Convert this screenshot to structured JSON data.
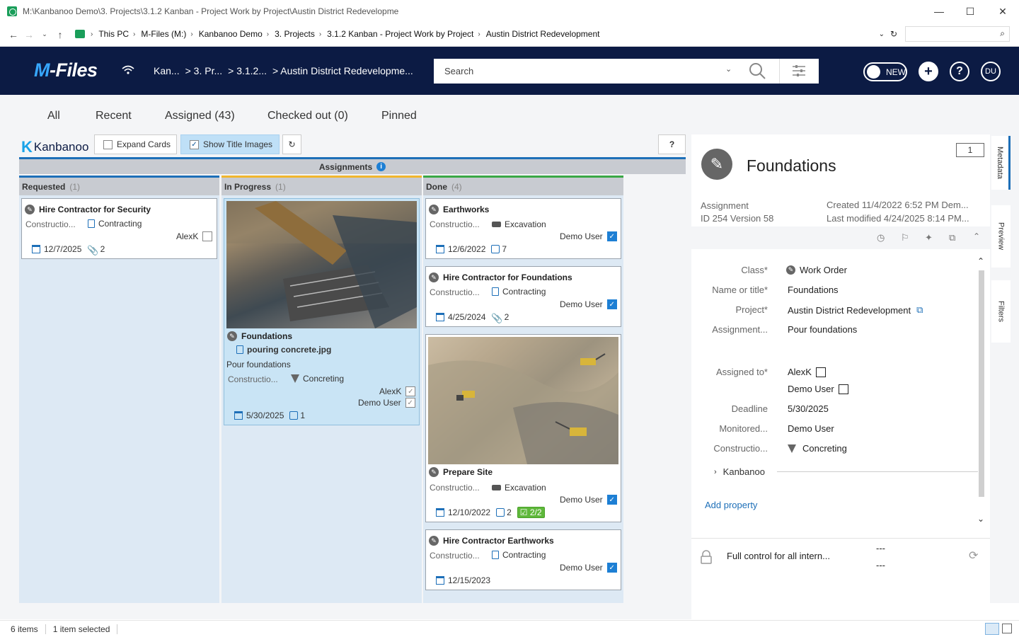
{
  "window": {
    "title": "M:\\Kanbanoo Demo\\3. Projects\\3.1.2 Kanban - Project Work by Project\\Austin District Redevelopme",
    "minimize": "—",
    "maximize": "☐",
    "close": "✕"
  },
  "address": {
    "crumbs": [
      "This PC",
      "M-Files (M:)",
      "Kanbanoo Demo",
      "3. Projects",
      "3.1.2 Kanban - Project Work by Project",
      "Austin District Redevelopment"
    ]
  },
  "header": {
    "logo_m": "M",
    "logo_rest": "-Files",
    "crumbs": [
      "Kan...",
      "> 3. Pr...",
      "> 3.1.2...",
      "> Austin District Redevelopme..."
    ],
    "search_placeholder": "Search",
    "new_label": "NEW",
    "user_initials": "DU"
  },
  "tabs": [
    "All",
    "Recent",
    "Assigned (43)",
    "Checked out (0)",
    "Pinned"
  ],
  "toolbar": {
    "brand": "Kanbanoo",
    "expand_cards": "Expand Cards",
    "show_title_images": "Show Title Images",
    "help": "?"
  },
  "board": {
    "title": "Assignments",
    "columns": [
      {
        "name": "Requested",
        "count": "(1)",
        "color": "#1d6fb8"
      },
      {
        "name": "In Progress",
        "count": "(1)",
        "color": "#f0b62e"
      },
      {
        "name": "Done",
        "count": "(4)",
        "color": "#3aa845"
      }
    ],
    "cards": {
      "c1": {
        "title": "Hire Contractor for Security",
        "category": "Constructio...",
        "type": "Contracting",
        "assignee": "AlexK",
        "date": "12/7/2025",
        "attachments": "2"
      },
      "c2": {
        "title": "Foundations",
        "file": "pouring concrete.jpg",
        "desc": "Pour foundations",
        "category": "Constructio...",
        "type": "Concreting",
        "assignee1": "AlexK",
        "assignee2": "Demo User",
        "date": "5/30/2025",
        "comments": "1"
      },
      "c3": {
        "title": "Earthworks",
        "category": "Constructio...",
        "type": "Excavation",
        "assignee": "Demo User",
        "date": "12/6/2022",
        "comments": "7"
      },
      "c4": {
        "title": "Hire Contractor for Foundations",
        "category": "Constructio...",
        "type": "Contracting",
        "assignee": "Demo User",
        "date": "4/25/2024",
        "attachments": "2"
      },
      "c5": {
        "title": "Prepare Site",
        "category": "Constructio...",
        "type": "Excavation",
        "assignee": "Demo User",
        "date": "12/10/2022",
        "comments": "2",
        "tasks": "2/2"
      },
      "c6": {
        "title": "Hire Contractor Earthworks",
        "category": "Constructio...",
        "type": "Contracting",
        "assignee": "Demo User",
        "date": "12/15/2023"
      }
    }
  },
  "panel": {
    "title": "Foundations",
    "comment_count": "1",
    "obj_type": "Assignment",
    "obj_id": "ID 254  Version 58",
    "created": "Created 11/4/2022 6:52 PM Dem...",
    "modified": "Last modified 4/24/2025 8:14 PM...",
    "props": {
      "class_label": "Class*",
      "class_value": "Work Order",
      "name_label": "Name or title*",
      "name_value": "Foundations",
      "project_label": "Project*",
      "project_value": "Austin District Redevelopment",
      "assign_label": "Assignment...",
      "assign_value": "Pour foundations",
      "assigned_label": "Assigned to*",
      "assigned_1": "AlexK",
      "assigned_2": "Demo User",
      "deadline_label": "Deadline",
      "deadline_value": "5/30/2025",
      "monitored_label": "Monitored...",
      "monitored_value": "Demo User",
      "constr_label": "Constructio...",
      "constr_value": "Concreting",
      "kanbanoo_group": "Kanbanoo"
    },
    "add_property": "Add property",
    "permissions": "Full control for all intern...",
    "dash1": "---",
    "dash2": "---"
  },
  "side_tabs": [
    "Metadata",
    "Preview",
    "Filters"
  ],
  "status": {
    "items": "6 items",
    "selected": "1 item selected"
  }
}
